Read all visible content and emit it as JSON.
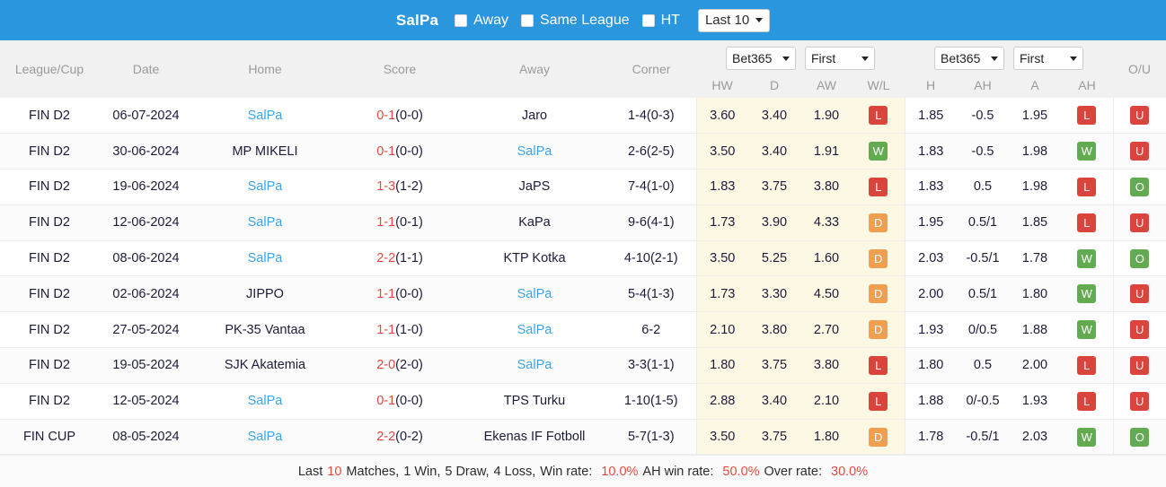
{
  "toolbar": {
    "team_name": "SalPa",
    "filters": [
      {
        "label": "Away",
        "checked": false
      },
      {
        "label": "Same League",
        "checked": false
      },
      {
        "label": "HT",
        "checked": false
      }
    ],
    "range_select": {
      "value": "Last 10"
    },
    "background_color": "#2a96dd"
  },
  "table": {
    "headers": {
      "league": "League/Cup",
      "date": "Date",
      "home": "Home",
      "score": "Score",
      "away": "Away",
      "corner": "Corner",
      "ou": "O/U"
    },
    "odds_group_left": {
      "bookmaker": "Bet365",
      "period": "First",
      "sub": [
        "HW",
        "D",
        "AW",
        "W/L"
      ]
    },
    "odds_group_right": {
      "bookmaker": "Bet365",
      "period": "First",
      "sub": [
        "H",
        "AH",
        "A",
        "AH"
      ]
    },
    "rows": [
      {
        "league": "FIN D2",
        "date": "06-07-2024",
        "home": "SalPa",
        "home_is_team": true,
        "score_main": "0-1",
        "score_ht": "(0-0)",
        "away": "Jaro",
        "away_is_team": false,
        "corner": "1-4(0-3)",
        "hw": "3.60",
        "d": "3.40",
        "aw": "1.90",
        "wl": "L",
        "h": "1.85",
        "ah1": "-0.5",
        "a": "1.95",
        "ah2": "L",
        "ou": "U"
      },
      {
        "league": "FIN D2",
        "date": "30-06-2024",
        "home": "MP MIKELI",
        "home_is_team": false,
        "score_main": "0-1",
        "score_ht": "(0-0)",
        "away": "SalPa",
        "away_is_team": true,
        "corner": "2-6(2-5)",
        "hw": "3.50",
        "d": "3.40",
        "aw": "1.91",
        "wl": "W",
        "h": "1.83",
        "ah1": "-0.5",
        "a": "1.98",
        "ah2": "W",
        "ou": "U"
      },
      {
        "league": "FIN D2",
        "date": "19-06-2024",
        "home": "SalPa",
        "home_is_team": true,
        "score_main": "1-3",
        "score_ht": "(1-2)",
        "away": "JaPS",
        "away_is_team": false,
        "corner": "7-4(1-0)",
        "hw": "1.83",
        "d": "3.75",
        "aw": "3.80",
        "wl": "L",
        "h": "1.83",
        "ah1": "0.5",
        "a": "1.98",
        "ah2": "L",
        "ou": "O"
      },
      {
        "league": "FIN D2",
        "date": "12-06-2024",
        "home": "SalPa",
        "home_is_team": true,
        "score_main": "1-1",
        "score_ht": "(0-1)",
        "away": "KaPa",
        "away_is_team": false,
        "corner": "9-6(4-1)",
        "hw": "1.73",
        "d": "3.90",
        "aw": "4.33",
        "wl": "D",
        "h": "1.95",
        "ah1": "0.5/1",
        "a": "1.85",
        "ah2": "L",
        "ou": "U"
      },
      {
        "league": "FIN D2",
        "date": "08-06-2024",
        "home": "SalPa",
        "home_is_team": true,
        "score_main": "2-2",
        "score_ht": "(1-1)",
        "away": "KTP Kotka",
        "away_is_team": false,
        "corner": "4-10(2-1)",
        "hw": "3.50",
        "d": "5.25",
        "aw": "1.60",
        "wl": "D",
        "h": "2.03",
        "ah1": "-0.5/1",
        "a": "1.78",
        "ah2": "W",
        "ou": "O"
      },
      {
        "league": "FIN D2",
        "date": "02-06-2024",
        "home": "JIPPO",
        "home_is_team": false,
        "score_main": "1-1",
        "score_ht": "(0-0)",
        "away": "SalPa",
        "away_is_team": true,
        "corner": "5-4(1-3)",
        "hw": "1.73",
        "d": "3.30",
        "aw": "4.50",
        "wl": "D",
        "h": "2.00",
        "ah1": "0.5/1",
        "a": "1.80",
        "ah2": "W",
        "ou": "U"
      },
      {
        "league": "FIN D2",
        "date": "27-05-2024",
        "home": "PK-35 Vantaa",
        "home_is_team": false,
        "score_main": "1-1",
        "score_ht": "(1-0)",
        "away": "SalPa",
        "away_is_team": true,
        "corner": "6-2",
        "hw": "2.10",
        "d": "3.80",
        "aw": "2.70",
        "wl": "D",
        "h": "1.93",
        "ah1": "0/0.5",
        "a": "1.88",
        "ah2": "W",
        "ou": "U"
      },
      {
        "league": "FIN D2",
        "date": "19-05-2024",
        "home": "SJK Akatemia",
        "home_is_team": false,
        "score_main": "2-0",
        "score_ht": "(2-0)",
        "away": "SalPa",
        "away_is_team": true,
        "corner": "3-3(1-1)",
        "hw": "1.80",
        "d": "3.75",
        "aw": "3.80",
        "wl": "L",
        "h": "1.80",
        "ah1": "0.5",
        "a": "2.00",
        "ah2": "L",
        "ou": "U"
      },
      {
        "league": "FIN D2",
        "date": "12-05-2024",
        "home": "SalPa",
        "home_is_team": true,
        "score_main": "0-1",
        "score_ht": "(0-0)",
        "away": "TPS Turku",
        "away_is_team": false,
        "corner": "1-10(1-5)",
        "hw": "2.88",
        "d": "3.40",
        "aw": "2.10",
        "wl": "L",
        "h": "1.88",
        "ah1": "0/-0.5",
        "a": "1.93",
        "ah2": "L",
        "ou": "U"
      },
      {
        "league": "FIN CUP",
        "date": "08-05-2024",
        "home": "SalPa",
        "home_is_team": true,
        "score_main": "2-2",
        "score_ht": "(0-2)",
        "away": "Ekenas IF Fotboll",
        "away_is_team": false,
        "corner": "5-7(1-3)",
        "hw": "3.50",
        "d": "3.75",
        "aw": "1.80",
        "wl": "D",
        "h": "1.78",
        "ah1": "-0.5/1",
        "a": "2.03",
        "ah2": "W",
        "ou": "O"
      }
    ]
  },
  "footer": {
    "prefix": "Last",
    "match_count": "10",
    "matches_word": "Matches,",
    "wins": "1 Win,",
    "draws": "5 Draw,",
    "losses": "4 Loss,",
    "win_rate_label": "Win rate:",
    "win_rate_value": "10.0%",
    "ah_win_rate_label": "AH win rate:",
    "ah_win_rate_value": "50.0%",
    "over_rate_label": "Over rate:",
    "over_rate_value": "30.0%"
  },
  "colors": {
    "accent_blue": "#2a96dd",
    "link_blue": "#3ba3e8",
    "score_red": "#e8493f",
    "win_green": "#63ab50",
    "loss_red": "#d9453d",
    "draw_orange": "#ef9f4f",
    "cream_highlight": "#fdf8e3"
  }
}
